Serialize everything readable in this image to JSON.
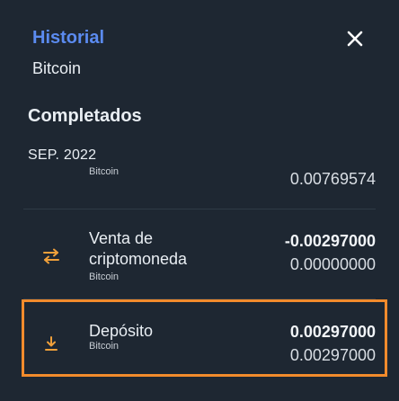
{
  "header": {
    "title": "Historial",
    "subtitle": "Bitcoin"
  },
  "section": {
    "title": "Completados",
    "month": "SEP. 2022"
  },
  "transactions": [
    {
      "name": "",
      "currency": "Bitcoin",
      "amount": "",
      "balance": "0.00769574",
      "icon": "arrow-up-icon"
    },
    {
      "name": "Venta de criptomoneda",
      "currency": "Bitcoin",
      "amount": "-0.00297000",
      "balance": "0.00000000",
      "icon": "swap-arrows-icon"
    },
    {
      "name": "Depósito",
      "currency": "Bitcoin",
      "amount": "0.00297000",
      "balance": "0.00297000",
      "icon": "download-icon"
    }
  ],
  "colors": {
    "background": "#1e2732",
    "accent": "#5b8bf0",
    "icon": "#f0a03a",
    "highlight": "#f28b2c"
  }
}
